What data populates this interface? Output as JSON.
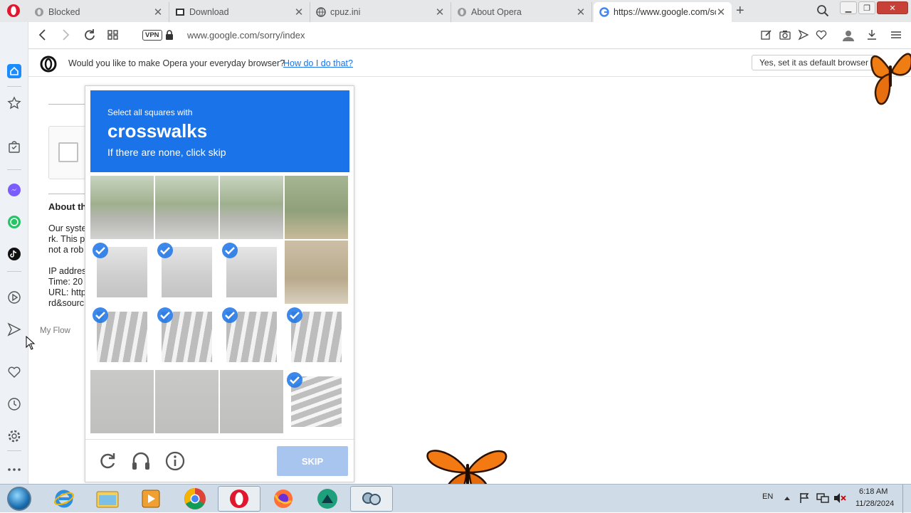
{
  "tabs": [
    {
      "title": "Blocked",
      "icon": "opera-icon"
    },
    {
      "title": "Download",
      "icon": "cpuz-icon"
    },
    {
      "title": "cpuz.ini",
      "icon": "globe-icon"
    },
    {
      "title": "About Opera",
      "icon": "opera-icon"
    },
    {
      "title": "https://www.google.com/so",
      "icon": "google-icon",
      "active": true
    }
  ],
  "addressbar": {
    "vpn_label": "VPN",
    "url": "www.google.com/sorry/index"
  },
  "sidebar": {
    "tooltip": "My Flow"
  },
  "default_prompt": {
    "message": "Would you like to make Opera your everyday browser?",
    "link": "How do I do that?",
    "button": "Yes, set it as default browser"
  },
  "page": {
    "heading": "About th",
    "lines": [
      "Our syste",
      "rk. This p",
      "not a rob",
      "IP addres",
      "Time: 20",
      "URL: http",
      "rd&sourc"
    ]
  },
  "captcha": {
    "instruction": "Select all squares with",
    "target": "crosswalks",
    "hint": "If there are none, click skip",
    "skip_label": "SKIP",
    "selected": [
      false,
      false,
      false,
      false,
      true,
      true,
      true,
      false,
      true,
      true,
      true,
      true,
      false,
      false,
      false,
      true
    ],
    "accent": "#1a73e8"
  },
  "taskbar": {
    "language": "EN",
    "time": "6:18 AM",
    "date": "11/28/2024"
  }
}
